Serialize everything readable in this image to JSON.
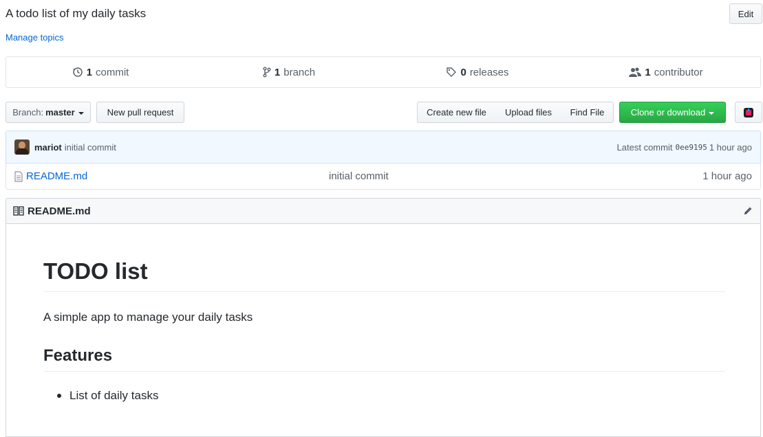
{
  "repo": {
    "description": "A todo list of my daily tasks",
    "edit_label": "Edit",
    "manage_topics": "Manage topics"
  },
  "numbers": [
    {
      "icon": "history-icon",
      "count": "1",
      "label": "commit"
    },
    {
      "icon": "git-branch-icon",
      "count": "1",
      "label": "branch"
    },
    {
      "icon": "tag-icon",
      "count": "0",
      "label": "releases"
    },
    {
      "icon": "people-icon",
      "count": "1",
      "label": "contributor"
    }
  ],
  "toolbar": {
    "branch_label": "Branch:",
    "branch_name": "master",
    "new_pull_request": "New pull request",
    "create_new_file": "Create new file",
    "upload_files": "Upload files",
    "find_file": "Find File",
    "clone_or_download": "Clone or download"
  },
  "commit": {
    "author": "mariot",
    "message": "initial commit",
    "latest_label": "Latest commit",
    "sha": "0ee9195",
    "age": "1 hour ago"
  },
  "files": [
    {
      "name": "README.md",
      "message": "initial commit",
      "age": "1 hour ago"
    }
  ],
  "readme": {
    "header": "README.md",
    "h1": "TODO list",
    "paragraph": "A simple app to manage your daily tasks",
    "h2": "Features",
    "items": [
      "List of daily tasks"
    ]
  },
  "colors": {
    "link": "#0366d6",
    "clone_button": "#28a745",
    "commit_bar_bg": "#f1f8ff"
  }
}
